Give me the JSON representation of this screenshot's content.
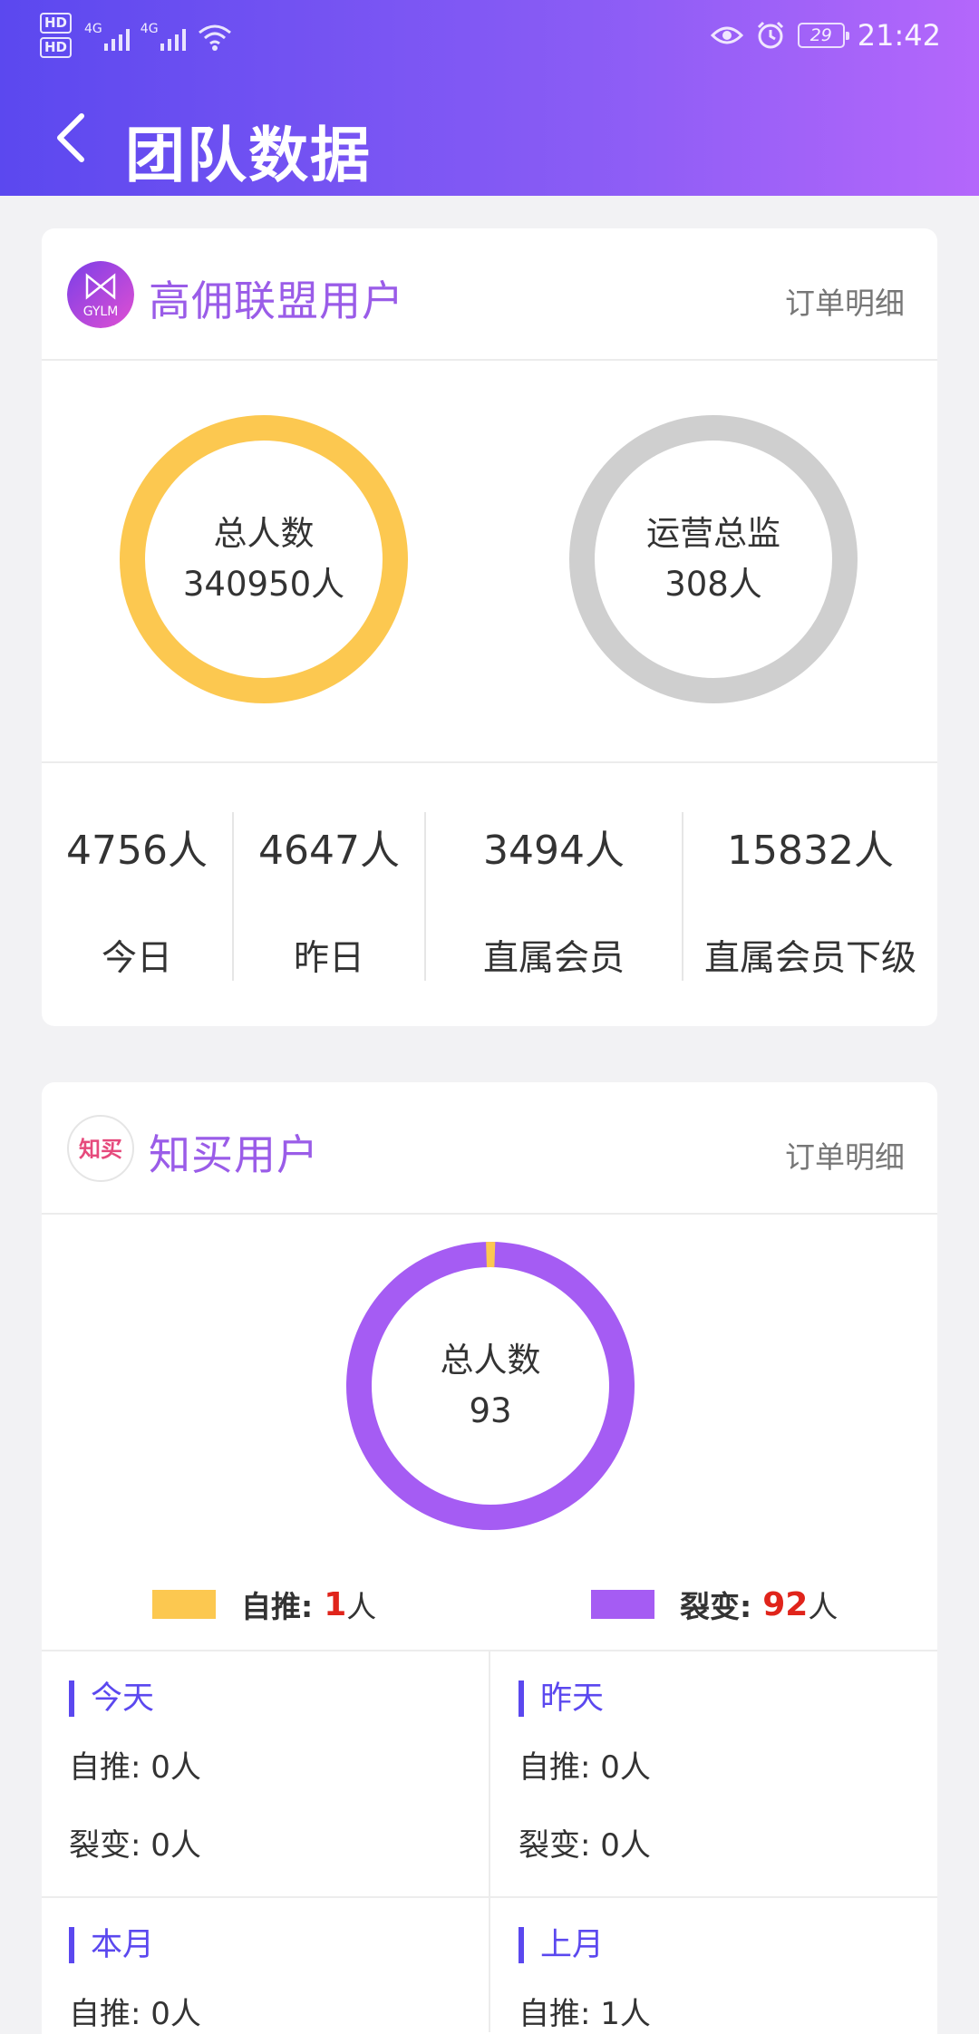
{
  "status_bar": {
    "hd1": "HD",
    "hd2": "HD",
    "net1": "4G",
    "net2": "4G",
    "battery": "29",
    "time": "21:42"
  },
  "header": {
    "title": "团队数据"
  },
  "gylm": {
    "name": "高佣联盟用户",
    "detail_link": "订单明细",
    "logo_text": "GYLM",
    "ring_total": {
      "label": "总人数",
      "value": "340950人"
    },
    "ring_director": {
      "label": "运营总监",
      "value": "308人"
    },
    "stats": [
      {
        "value": "4756人",
        "label": "今日"
      },
      {
        "value": "4647人",
        "label": "昨日"
      },
      {
        "value": "3494人",
        "label": "直属会员"
      },
      {
        "value": "15832人",
        "label": "直属会员下级"
      }
    ]
  },
  "zhimai": {
    "name": "知买用户",
    "detail_link": "订单明细",
    "logo_text": "知买",
    "donut": {
      "label": "总人数",
      "value": "93",
      "self_count": 1,
      "fission_count": 92
    },
    "legend": {
      "self": {
        "label": "自推:",
        "value": "1",
        "unit": "人",
        "color": "#fcc850"
      },
      "fission": {
        "label": "裂变:",
        "value": "92",
        "unit": "人",
        "color": "#a55cf3"
      }
    },
    "periods": [
      {
        "title": "今天",
        "self": "自推: 0人",
        "fission": "裂变: 0人"
      },
      {
        "title": "昨天",
        "self": "自推: 0人",
        "fission": "裂变: 0人"
      },
      {
        "title": "本月",
        "self": "自推: 0人"
      },
      {
        "title": "上月",
        "self": "自推: 1人"
      }
    ]
  },
  "colors": {
    "accent": "#5b48ef",
    "brand_purple": "#9a5ce8",
    "ring_yellow": "#fcc850",
    "ring_gray": "#cfcfcf",
    "highlight_red": "#e0241b"
  }
}
